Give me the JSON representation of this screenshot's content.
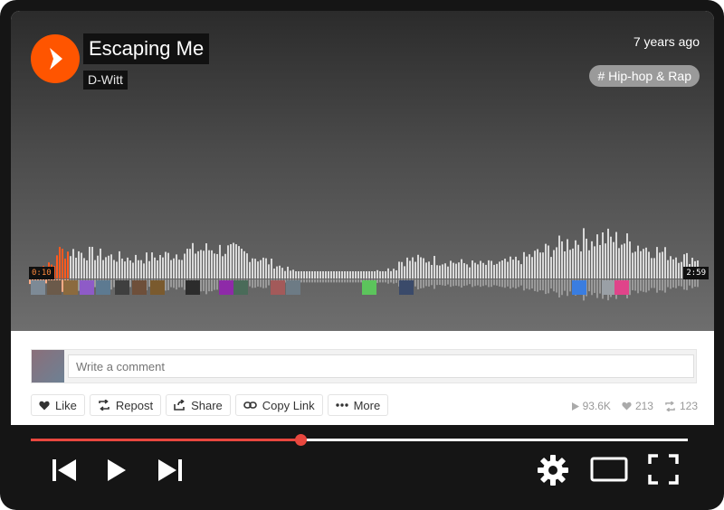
{
  "track": {
    "title": "Escaping Me",
    "artist": "D-Witt",
    "posted": "7 years ago",
    "tag": "# Hip-hop & Rap"
  },
  "waveform": {
    "current_time": "0:10",
    "duration": "2:59",
    "played_fraction": 0.057
  },
  "comment": {
    "placeholder": "Write a comment"
  },
  "actions": [
    {
      "label": "Like",
      "icon": "heart-icon"
    },
    {
      "label": "Repost",
      "icon": "repost-icon"
    },
    {
      "label": "Share",
      "icon": "share-icon"
    },
    {
      "label": "Copy Link",
      "icon": "link-icon"
    },
    {
      "label": "More",
      "icon": "more-icon"
    }
  ],
  "stats": {
    "plays": "93.6K",
    "likes": "213",
    "reposts": "123"
  },
  "player": {
    "progress": 0.41
  },
  "colors": {
    "brand": "#ff5500",
    "progress": "#e8473e"
  }
}
